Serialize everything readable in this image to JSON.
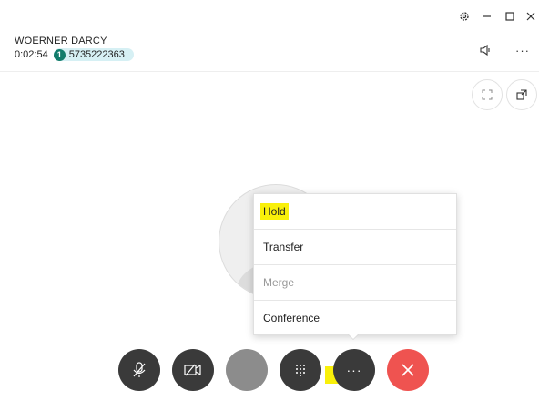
{
  "window": {
    "settings_icon": "gear-icon",
    "minimize_icon": "minimize-icon",
    "maximize_icon": "maximize-icon",
    "close_icon": "close-icon"
  },
  "call": {
    "caller_name": "WOERNER DARCY",
    "duration": "0:02:54",
    "line_number": "1",
    "phone_number": "5735222363"
  },
  "header_actions": {
    "speaker_icon": "speaker-icon",
    "more_label": "···"
  },
  "view_tools": {
    "fullscreen_icon": "fullscreen-icon",
    "popout_icon": "popout-icon"
  },
  "more_menu": {
    "items": [
      {
        "label": "Hold",
        "enabled": true,
        "highlighted": true
      },
      {
        "label": "Transfer",
        "enabled": true
      },
      {
        "label": "Merge",
        "enabled": false
      },
      {
        "label": "Conference",
        "enabled": true
      }
    ]
  },
  "controls": {
    "mute_icon": "microphone-off-icon",
    "video_icon": "video-off-icon",
    "keypad_icon": "dialpad-icon",
    "more_label": "···",
    "end_call_icon": "end-call-icon",
    "colors": {
      "dark": "#3a3a3a",
      "inactive": "#8c8c8c",
      "end_call": "#ef5350",
      "highlight": "#f9f00a",
      "line_badge": "#127c6b"
    }
  }
}
